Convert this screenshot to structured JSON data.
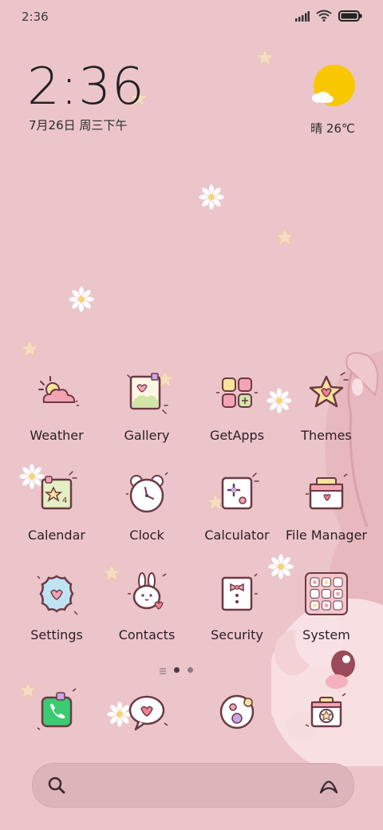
{
  "status_bar": {
    "time": "2:36",
    "icons": [
      "signal-icon",
      "wifi-icon",
      "battery-icon"
    ]
  },
  "clock_widget": {
    "time": "2:36",
    "date": "7月26日 周三下午"
  },
  "weather_widget": {
    "text": "晴 26℃",
    "icon": "sun-cloud-icon"
  },
  "apps": [
    {
      "label": "Weather",
      "icon": "weather-icon"
    },
    {
      "label": "Gallery",
      "icon": "gallery-icon"
    },
    {
      "label": "GetApps",
      "icon": "getapps-icon"
    },
    {
      "label": "Themes",
      "icon": "themes-icon"
    },
    {
      "label": "Calendar",
      "icon": "calendar-icon"
    },
    {
      "label": "Clock",
      "icon": "clock-icon"
    },
    {
      "label": "Calculator",
      "icon": "calculator-icon"
    },
    {
      "label": "File Manager",
      "icon": "file-manager-icon"
    },
    {
      "label": "Settings",
      "icon": "settings-icon"
    },
    {
      "label": "Contacts",
      "icon": "contacts-icon"
    },
    {
      "label": "Security",
      "icon": "security-icon"
    },
    {
      "label": "System",
      "icon": "system-icon"
    }
  ],
  "dock": [
    {
      "icon": "phone-icon"
    },
    {
      "icon": "messages-icon"
    },
    {
      "icon": "browser-icon"
    },
    {
      "icon": "camera-icon"
    }
  ],
  "pager": {
    "pages": 2,
    "active": 1
  },
  "search": {
    "left_icon": "search-icon",
    "right_icon": "assistant-icon"
  },
  "colors": {
    "background": "#ecc5ca",
    "accent_pink": "#f4a3b3",
    "accent_yellow": "#fbe39a",
    "sun": "#f9c700"
  }
}
